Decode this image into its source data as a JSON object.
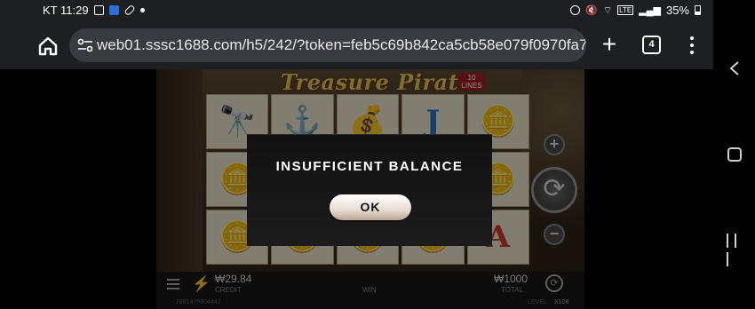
{
  "status_bar": {
    "carrier_time": "KT 11:29",
    "battery": "35%"
  },
  "browser": {
    "url": "web01.sssc1688.com/h5/242/?token=feb5c69b842ca5cb58e079f0970fa730&l",
    "tab_count": "4",
    "new_tab_label": "+"
  },
  "game": {
    "title": "Treasure Pirate",
    "lines_badge": "10 LINES",
    "reels": [
      [
        "🔭",
        "⚓",
        "💰",
        "J",
        "🪙"
      ],
      [
        "🪙",
        "🪙",
        "🪙",
        "🪙",
        "🪙"
      ],
      [
        "🪙",
        "🪙",
        "🪙",
        "🪙",
        "A"
      ]
    ],
    "plus_label": "+",
    "minus_label": "−",
    "spin_label": "⟳",
    "credit_value": "₩29.84",
    "credit_label": "CREDIT",
    "win_label": "WIN",
    "total_value": "₩1000",
    "total_label": "TOTAL",
    "session_id": "7891475904442",
    "level_label": "LEVEL",
    "level_value": "X108"
  },
  "modal": {
    "title": "INSUFFICIENT BALANCE",
    "ok_label": "OK"
  }
}
